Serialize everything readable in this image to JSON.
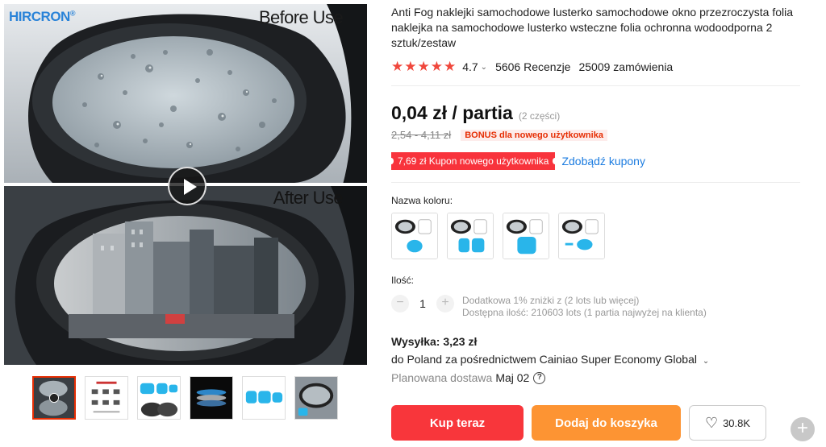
{
  "gallery": {
    "brand_logo": "HIRCRON",
    "caption_before": "Before Use",
    "caption_after": "After Use",
    "play_icon": "play-icon",
    "thumbnail_count": 6,
    "active_thumbnail": 1
  },
  "product": {
    "title": "Anti Fog naklejki samochodowe lusterko samochodowe okno przezroczysta folia naklejka na samochodowe lusterko wsteczne folia ochronna wodoodporna 2 sztuk/zestaw",
    "stars": "★★★★★",
    "rating": "4.7",
    "reviews": "5606 Recenzje",
    "orders": "25009 zamówienia"
  },
  "pricing": {
    "price": "0,04 zł / partia",
    "pieces": "(2 części)",
    "old_price": "2,54 - 4,11 zł",
    "bonus_badge": "BONUS dla nowego użytkownika",
    "coupon": "7,69 zł Kupon nowego użytkownika",
    "coupon_link": "Zdobądź kupony"
  },
  "options": {
    "color_label": "Nazwa koloru:",
    "color_count": 4
  },
  "quantity": {
    "label": "Ilość:",
    "minus": "−",
    "plus": "+",
    "value": "1",
    "note_discount": "Dodatkowa 1% zniżki z (2 lots lub więcej)",
    "note_available": "Dostępna ilość: 210603 lots (1 partia najwyżej na klienta)"
  },
  "shipping": {
    "cost": "Wysyłka: 3,23 zł",
    "via": "do Poland za pośrednictwem Cainiao Super Economy Global",
    "delivery_label": "Planowana dostawa",
    "delivery_date": "Maj 02",
    "help": "?"
  },
  "actions": {
    "buy_now": "Kup teraz",
    "add_to_cart": "Dodaj do koszyka",
    "wishlist_count": "30.8K",
    "heart_icon": "heart-icon",
    "fab": "+"
  },
  "colors": {
    "price_red": "#f8363b",
    "cart_orange": "#fd9433",
    "link_blue": "#1c7ce0",
    "star_red": "#f0473c"
  }
}
